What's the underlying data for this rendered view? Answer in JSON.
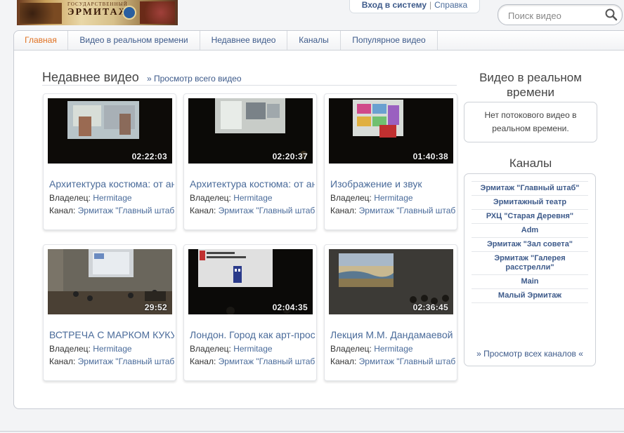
{
  "logo": {
    "small_text": "ГОСУДАРСТВЕННЫЙ",
    "main_text": "ЭРМИТАЖ"
  },
  "account": {
    "login_label": "Вход в систему",
    "separator": "|",
    "help_label": "Справка"
  },
  "search": {
    "placeholder": "Поиск видео"
  },
  "nav": {
    "items": [
      {
        "label": "Главная",
        "active": true
      },
      {
        "label": "Видео в реальном времени"
      },
      {
        "label": "Недавнее видео"
      },
      {
        "label": "Каналы"
      },
      {
        "label": "Популярное видео"
      }
    ]
  },
  "recent": {
    "title": "Недавнее видео",
    "view_all": "» Просмотр всего видео",
    "owner_label": "Владелец:",
    "channel_label": "Канал:",
    "videos": [
      {
        "title": "Архитектура костюма: от античности",
        "duration": "02:22:03",
        "owner": "Hermitage",
        "channel": "Эрмитаж \"Главный штаб\""
      },
      {
        "title": "Архитектура костюма: от античности",
        "duration": "02:20:37",
        "owner": "Hermitage",
        "channel": "Эрмитаж \"Главный штаб\""
      },
      {
        "title": "Изображение и звук",
        "duration": "01:40:38",
        "owner": "Hermitage",
        "channel": "Эрмитаж \"Главный штаб\""
      },
      {
        "title": "ВСТРЕЧА С МАРКОМ КУКУШКИНЫМ",
        "duration": "29:52",
        "owner": "Hermitage",
        "channel": "Эрмитаж \"Главный штаб\""
      },
      {
        "title": "Лондон. Город как арт-пространство",
        "duration": "02:04:35",
        "owner": "Hermitage",
        "channel": "Эрмитаж \"Главный штаб\""
      },
      {
        "title": "Лекция М.М. Дандамаевой",
        "duration": "02:36:45",
        "owner": "Hermitage",
        "channel": "Эрмитаж \"Главный штаб\""
      }
    ]
  },
  "live": {
    "title": "Видео в реальном времени",
    "empty_text": "Нет потокового видео в реальном времени."
  },
  "channels": {
    "title": "Каналы",
    "items": [
      "Эрмитаж \"Главный штаб\"",
      "Эрмитажный театр",
      "РХЦ \"Старая Деревня\"",
      "Adm",
      "Эрмитаж \"Зал совета\"",
      "Эрмитаж \"Галерея расстрелли\"",
      "Main",
      "Малый Эрмитаж"
    ],
    "view_all": "» Просмотр всех каналов «"
  }
}
